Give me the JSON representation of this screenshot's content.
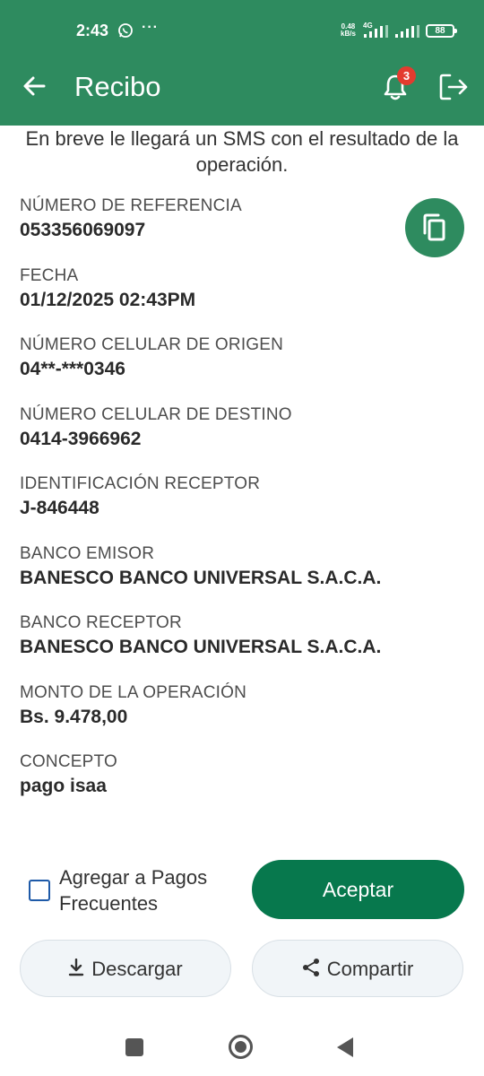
{
  "status_bar": {
    "time": "2:43",
    "more": "···",
    "speed_value": "0.48",
    "speed_unit": "kB/s",
    "network": "4G",
    "battery": "88"
  },
  "app_bar": {
    "title": "Recibo",
    "notification_count": "3"
  },
  "notice": "En breve le llegará un SMS con el resultado de la operación.",
  "fields": [
    {
      "label": "NÚMERO DE REFERENCIA",
      "value": "053356069097"
    },
    {
      "label": "FECHA",
      "value": "01/12/2025 02:43PM"
    },
    {
      "label": "NÚMERO CELULAR DE ORIGEN",
      "value": "04**-***0346"
    },
    {
      "label": "NÚMERO CELULAR DE DESTINO",
      "value": "0414-3966962"
    },
    {
      "label": "IDENTIFICACIÓN RECEPTOR",
      "value": "J-846448"
    },
    {
      "label": "BANCO EMISOR",
      "value": "BANESCO BANCO UNIVERSAL S.A.C.A."
    },
    {
      "label": "BANCO RECEPTOR",
      "value": "BANESCO BANCO UNIVERSAL S.A.C.A."
    },
    {
      "label": "MONTO DE LA OPERACIÓN",
      "value": "Bs. 9.478,00"
    },
    {
      "label": "CONCEPTO",
      "value": "pago isaa"
    }
  ],
  "actions": {
    "frequent_checkbox_label": "Agregar a Pagos Frecuentes",
    "frequent_checked": false,
    "accept_label": "Aceptar",
    "download_label": "Descargar",
    "share_label": "Compartir"
  },
  "icons": {
    "back": "arrow-left-icon",
    "notifications": "bell-icon",
    "logout": "logout-icon",
    "copy": "copy-icon",
    "download": "download-icon",
    "share": "share-icon"
  },
  "colors": {
    "primary": "#2e8b5f",
    "primary_dark": "#07784d",
    "badge": "#e33b2f",
    "checkbox": "#1e5aa8"
  }
}
